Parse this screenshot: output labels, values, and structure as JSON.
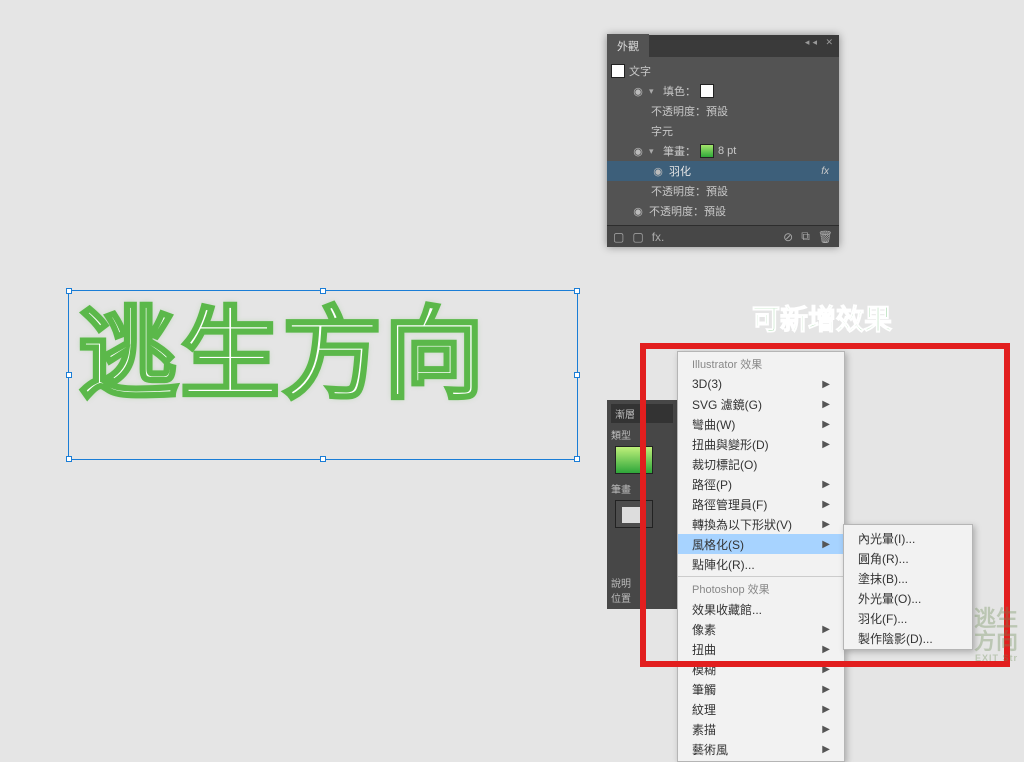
{
  "canvas": {
    "text": "逃生方向"
  },
  "annotation": "可新增效果",
  "panel": {
    "title": "外觀",
    "rows": {
      "text_type": "文字",
      "fill_label": "填色：",
      "opacity_default": "不透明度：預設",
      "char": "字元",
      "stroke_label": "筆畫：",
      "stroke_size": "8 pt",
      "feather": "羽化",
      "opacity_default2": "不透明度：預設",
      "opacity_bottom": "不透明度：預設"
    },
    "footer_fx": "fx."
  },
  "panel2": {
    "title": "漸層",
    "row1": "類型",
    "row2": "筆畫",
    "row3": "說明",
    "row4": "位置"
  },
  "menu": {
    "header1": "Illustrator 效果",
    "items1": [
      {
        "label": "3D(3)",
        "arrow": true
      },
      {
        "label": "SVG 濾鏡(G)",
        "arrow": true
      },
      {
        "label": "彎曲(W)",
        "arrow": true
      },
      {
        "label": "扭曲與變形(D)",
        "arrow": true
      },
      {
        "label": "裁切標記(O)",
        "arrow": false
      },
      {
        "label": "路徑(P)",
        "arrow": true
      },
      {
        "label": "路徑管理員(F)",
        "arrow": true
      },
      {
        "label": "轉換為以下形狀(V)",
        "arrow": true
      },
      {
        "label": "風格化(S)",
        "arrow": true,
        "selected": true
      },
      {
        "label": "點陣化(R)...",
        "arrow": false
      }
    ],
    "header2": "Photoshop 效果",
    "items2": [
      {
        "label": "效果收藏館...",
        "arrow": false
      },
      {
        "label": "像素",
        "arrow": true
      },
      {
        "label": "扭曲",
        "arrow": true
      },
      {
        "label": "模糊",
        "arrow": true
      },
      {
        "label": "筆觸",
        "arrow": true
      },
      {
        "label": "紋理",
        "arrow": true
      },
      {
        "label": "素描",
        "arrow": true
      },
      {
        "label": "藝術風",
        "arrow": true
      }
    ]
  },
  "submenu": {
    "items": [
      "內光暈(I)...",
      "圓角(R)...",
      "塗抹(B)...",
      "外光暈(O)...",
      "羽化(F)...",
      "製作陰影(D)..."
    ]
  },
  "watermark": {
    "line1": "逃生",
    "line2": "方向",
    "small": "EXIT Str"
  }
}
